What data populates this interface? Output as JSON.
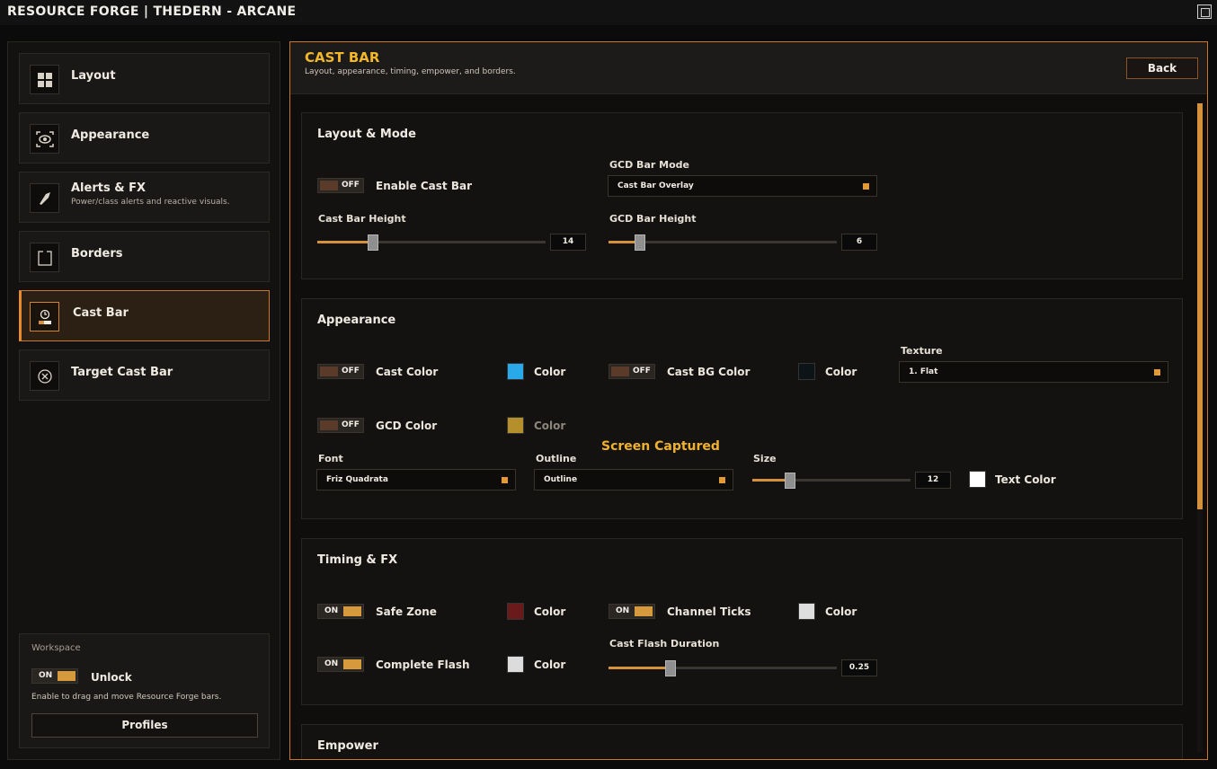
{
  "window": {
    "title": "RESOURCE FORGE | THEDERN - ARCANE"
  },
  "sidebar": {
    "items": [
      {
        "label": "Layout",
        "icon": "grid-icon"
      },
      {
        "label": "Appearance",
        "icon": "eye-icon"
      },
      {
        "label": "Alerts & FX",
        "desc": "Power/class alerts and reactive visuals.",
        "icon": "bell-icon"
      },
      {
        "label": "Borders",
        "icon": "square-icon"
      },
      {
        "label": "Cast Bar",
        "icon": "cast-bar-icon",
        "active": true
      },
      {
        "label": "Target Cast Bar",
        "icon": "target-icon"
      }
    ],
    "workspace": {
      "title": "Workspace",
      "unlock_toggle": "ON",
      "unlock_label": "Unlock",
      "desc": "Enable to drag and move Resource Forge bars.",
      "profiles_label": "Profiles"
    }
  },
  "main": {
    "title": "CAST BAR",
    "subtitle": "Layout, appearance, timing, empower, and borders.",
    "back_label": "Back",
    "layout_mode": {
      "title": "Layout & Mode",
      "enable_toggle": "OFF",
      "enable_label": "Enable Cast Bar",
      "gcd_mode_label": "GCD Bar Mode",
      "gcd_mode_value": "Cast Bar Overlay",
      "cast_height_label": "Cast Bar Height",
      "cast_height_value": "14",
      "cast_height_fraction": 0.23,
      "gcd_height_label": "GCD Bar Height",
      "gcd_height_value": "6",
      "gcd_height_fraction": 0.12
    },
    "appearance": {
      "title": "Appearance",
      "cast_color_toggle": "OFF",
      "cast_color_label": "Cast Color",
      "cast_color_swatch": "#29a8ea",
      "color_label": "Color",
      "cast_bg_toggle": "OFF",
      "cast_bg_label": "Cast BG Color",
      "cast_bg_swatch": "#0c1418",
      "texture_label": "Texture",
      "texture_value": "1. Flat",
      "gcd_color_toggle": "OFF",
      "gcd_color_label": "GCD Color",
      "gcd_color_swatch": "#b58f2c",
      "font_label": "Font",
      "font_value": "Friz Quadrata",
      "outline_label": "Outline",
      "outline_value": "Outline",
      "size_label": "Size",
      "size_value": "12",
      "size_fraction": 0.22,
      "text_color_label": "Text Color",
      "text_color_swatch": "#ffffff"
    },
    "timing": {
      "title": "Timing & FX",
      "safe_zone_toggle": "ON",
      "safe_zone_label": "Safe Zone",
      "safe_zone_swatch": "#6a1a1a",
      "channel_toggle": "ON",
      "channel_label": "Channel Ticks",
      "channel_swatch": "#dedede",
      "flash_toggle": "ON",
      "flash_label": "Complete Flash",
      "flash_swatch": "#dcdcdc",
      "flash_duration_label": "Cast Flash Duration",
      "flash_duration_value": "0.25",
      "flash_duration_fraction": 0.26,
      "color_label": "Color"
    },
    "empower": {
      "title": "Empower"
    },
    "overlay_text": "Screen Captured"
  },
  "colors": {
    "accent": "#d6923a",
    "title": "#f2b82a",
    "active_border": "#e68a2c"
  }
}
